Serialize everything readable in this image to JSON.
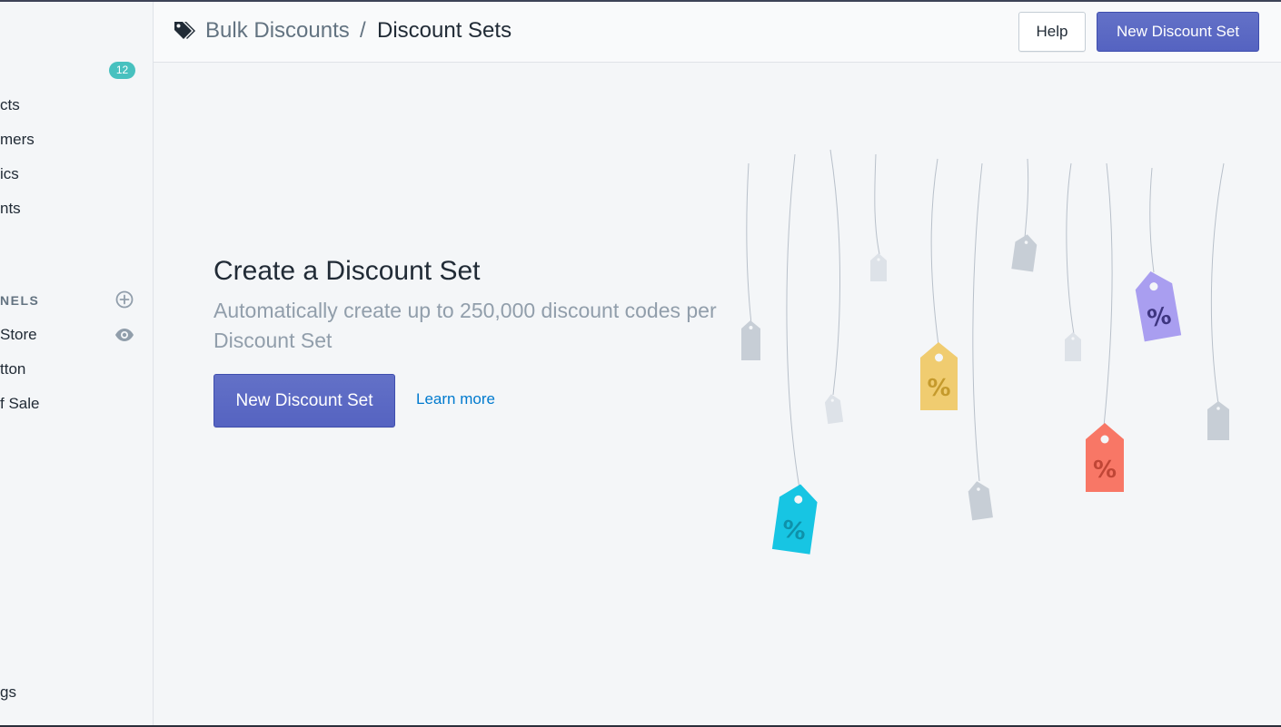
{
  "sidebar": {
    "badge": "12",
    "items": [
      {
        "label": "cts"
      },
      {
        "label": "mers"
      },
      {
        "label": "ics"
      },
      {
        "label": "nts"
      }
    ],
    "section_label": "NELS",
    "channels": [
      {
        "label": " Store"
      },
      {
        "label": "tton"
      },
      {
        "label": "f Sale"
      }
    ],
    "bottom_item": "gs"
  },
  "header": {
    "breadcrumb_parent": "Bulk Discounts",
    "breadcrumb_separator": "/",
    "breadcrumb_current": "Discount Sets",
    "help_label": "Help",
    "primary_label": "New Discount Set"
  },
  "empty_state": {
    "title": "Create a Discount Set",
    "description": "Automatically create up to 250,000 discount codes per Discount Set",
    "primary_label": "New Discount Set",
    "secondary_label": "Learn more"
  },
  "illustration": {
    "tag_symbol": "%",
    "colors": {
      "cyan": "#17c5e3",
      "yellow": "#f0cc70",
      "red": "#f87766",
      "purple": "#a99ef0",
      "gray": "#c7ced6",
      "light_gray": "#dde2e8"
    }
  },
  "colors": {
    "accent": "#5c6ac4",
    "link": "#007ace",
    "badge": "#47c1bf"
  }
}
